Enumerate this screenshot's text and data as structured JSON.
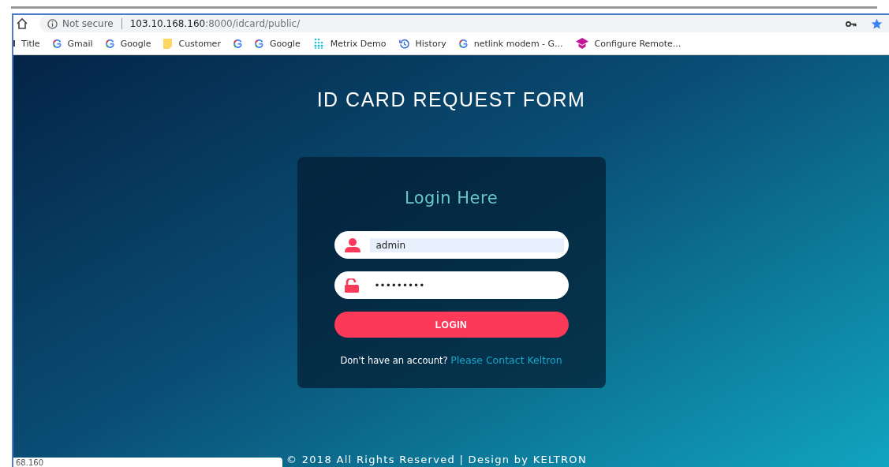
{
  "address_bar": {
    "security": "Not secure",
    "host": "103.10.168.160",
    "path": ":8000/idcard/public/"
  },
  "bookmarks": [
    {
      "kind": "none",
      "label": "Title"
    },
    {
      "kind": "google",
      "label": "Gmail"
    },
    {
      "kind": "google",
      "label": "Google"
    },
    {
      "kind": "folder",
      "label": "Customer"
    },
    {
      "kind": "google"
    },
    {
      "kind": "google",
      "label": "Google"
    },
    {
      "kind": "dots",
      "label": "Metrix Demo"
    },
    {
      "kind": "history",
      "label": "History"
    },
    {
      "kind": "google",
      "label": "netlink modem - G..."
    },
    {
      "kind": "cap",
      "label": "Configure Remote..."
    }
  ],
  "page": {
    "title": "ID CARD REQUEST FORM",
    "login": {
      "heading": "Login Here",
      "username": {
        "value": "admin"
      },
      "password": {
        "value": "•••••••••"
      },
      "button": "LOGIN",
      "prompt": "Don't have an account?",
      "link": "Please Contact Keltron"
    },
    "footer": "© 2018 All Rights Reserved | Design by KELTRON"
  },
  "status_bubble": "68.160"
}
